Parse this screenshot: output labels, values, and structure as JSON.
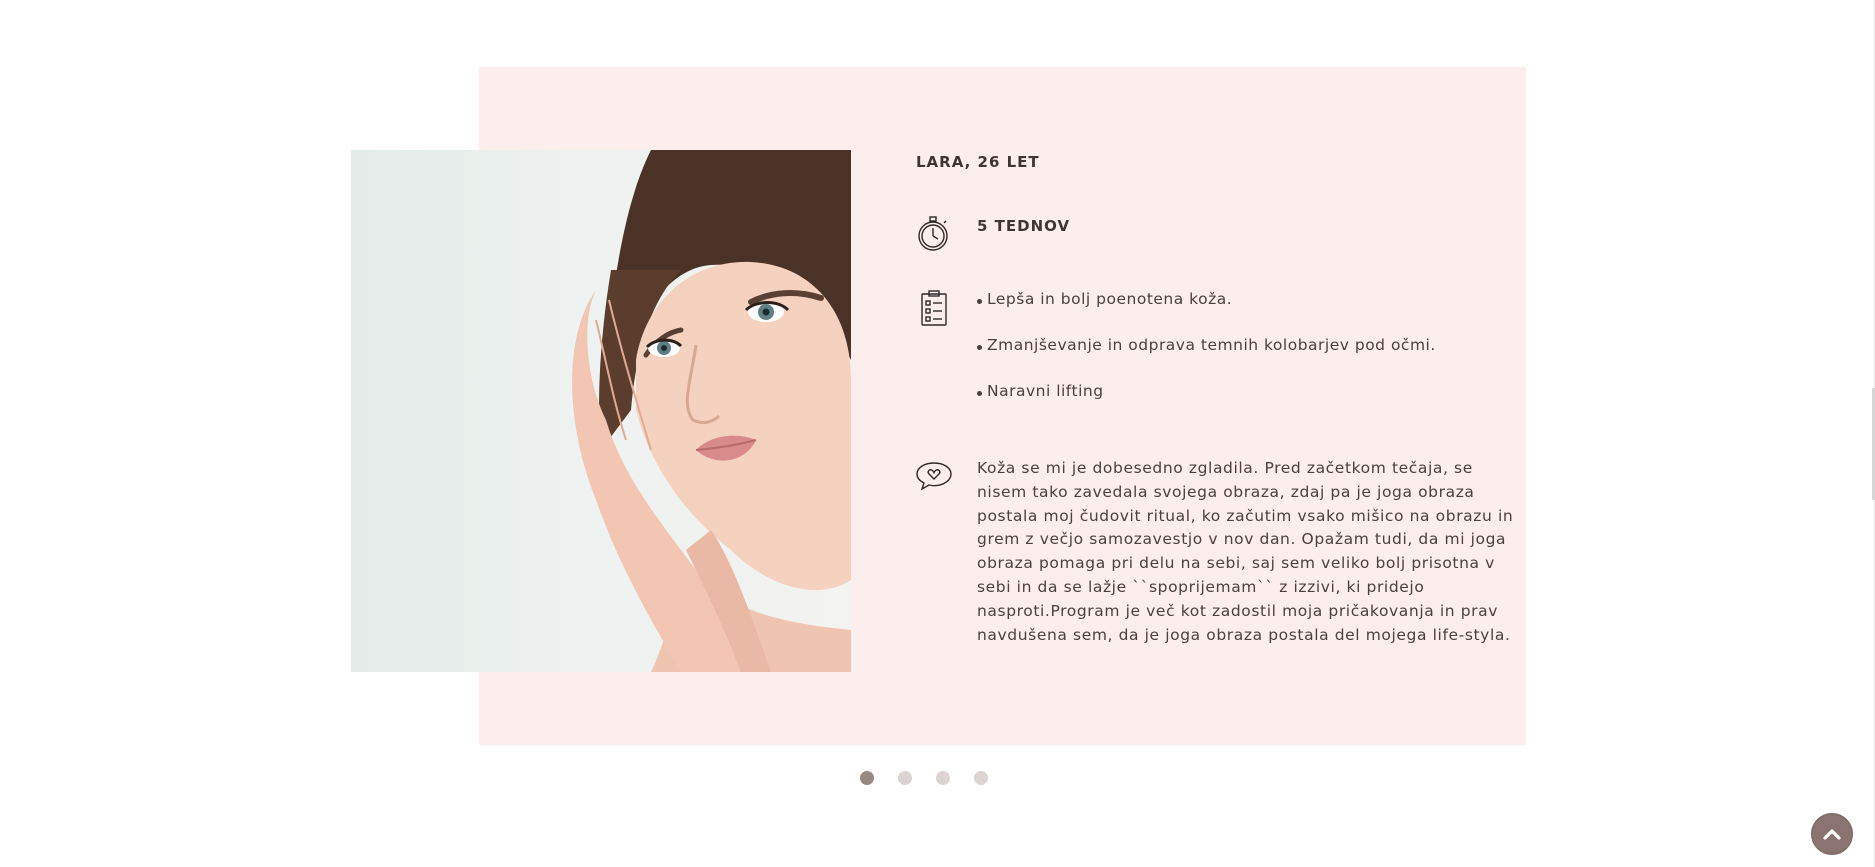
{
  "testimonial": {
    "person": "LARA, 26 LET",
    "duration": "5 TEDNOV",
    "benefits": [
      "Lepša in bolj poenotena koža.",
      "Zmanjševanje in odprava temnih kolobarjev pod očmi.",
      "Naravni lifting"
    ],
    "quote": "Koža se mi je dobesedno zgladila. Pred začetkom tečaja, se nisem tako zavedala svojega obraza, zdaj pa je joga obraza postala moj čudovit ritual, ko začutim vsako mišico na obrazu in grem z večjo samozavestjo v nov dan. Opažam tudi, da mi joga obraza pomaga pri delu na sebi, saj sem veliko bolj prisotna v sebi in da se lažje ``spoprijemam`` z izzivi, ki pridejo nasproti.Program je več kot zadostil moja pričakovanja in prav navdušena sem, da je joga obraza postala del mojega life-styla.",
    "icons": [
      "stopwatch-icon",
      "clipboard-list-icon",
      "speech-bubble-heart-icon"
    ]
  },
  "carousel": {
    "slides": 4,
    "active": 1
  },
  "back_to_top": {
    "icon": "chevron-up-icon"
  },
  "colors": {
    "card": "#fdeeee",
    "accent": "#8a7370",
    "dot_active": "#9a8882",
    "dot": "#dcd4d2",
    "text": "#4a4040"
  }
}
